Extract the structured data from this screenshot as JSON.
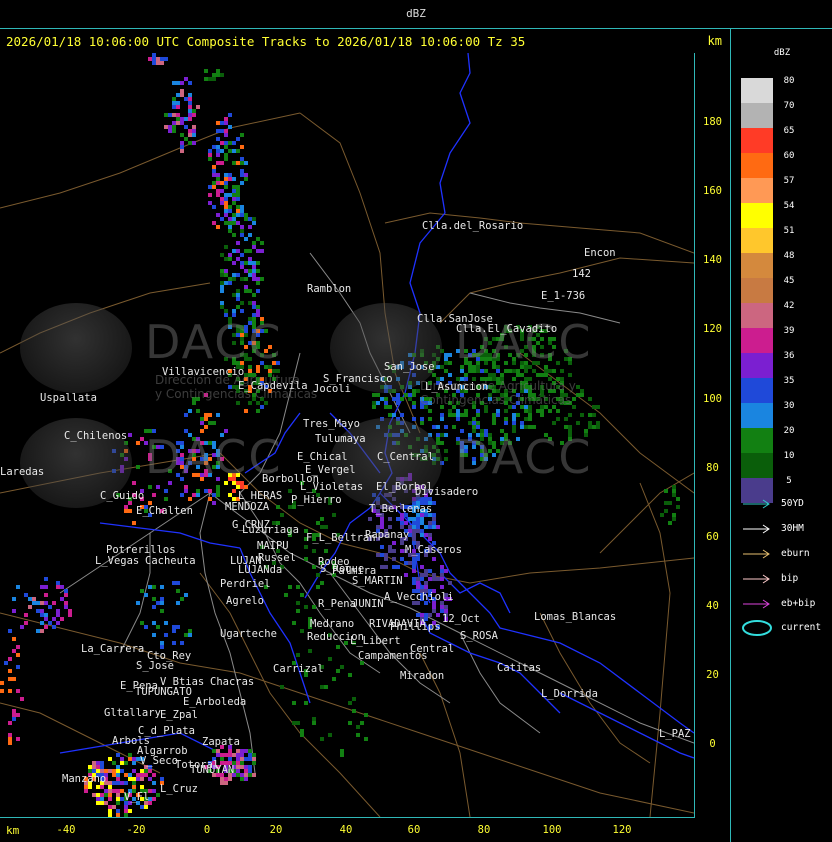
{
  "top_title": "dBZ",
  "header": {
    "title": "2026/01/18 10:06:00 UTC Composite Tracks to 2026/01/18 10:06:00 Tz 35",
    "km": "km"
  },
  "y_ticks": [
    "180",
    "160",
    "140",
    "120",
    "100",
    "80",
    "60",
    "40",
    "20",
    "0"
  ],
  "x_ticks": [
    "-40",
    "-20",
    "0",
    "20",
    "40",
    "60",
    "80",
    "100",
    "120"
  ],
  "x_km": "km",
  "legend": {
    "title": "dBZ",
    "scale": [
      {
        "value": "80",
        "color": "#d9d9d9"
      },
      {
        "value": "70",
        "color": "#b3b3b3"
      },
      {
        "value": "65",
        "color": "#ff3b26"
      },
      {
        "value": "60",
        "color": "#ff6a12"
      },
      {
        "value": "57",
        "color": "#ff9955"
      },
      {
        "value": "54",
        "color": "#ffff00"
      },
      {
        "value": "51",
        "color": "#ffc72c"
      },
      {
        "value": "48",
        "color": "#d4893d"
      },
      {
        "value": "45",
        "color": "#c87a42"
      },
      {
        "value": "42",
        "color": "#cc6680"
      },
      {
        "value": "39",
        "color": "#cc1d8f"
      },
      {
        "value": "36",
        "color": "#7b1fd1"
      },
      {
        "value": "35",
        "color": "#1f49d9"
      },
      {
        "value": "30",
        "color": "#1a85e0"
      },
      {
        "value": "20",
        "color": "#128012"
      },
      {
        "value": "10",
        "color": "#0a5e0a"
      },
      {
        "value": "5",
        "color": "#4a3c8c"
      }
    ],
    "tracks": [
      {
        "label": "50YD",
        "color": "#33cccc"
      },
      {
        "label": "30HM",
        "color": "#ffffff"
      },
      {
        "label": "eburn",
        "color": "#e8c070"
      },
      {
        "label": "bip",
        "color": "#ffcccc"
      },
      {
        "label": "eb+bip",
        "color": "#dd44dd"
      }
    ],
    "current_label": "current",
    "current_color": "#33dddd"
  },
  "watermark": {
    "brand": "DACC",
    "sub_right": "Dirección de Agricultura y Contingencias Climáticas",
    "sub_left_1": "Dirección de Agricultura",
    "sub_left_2": "y Contingencias Climáticas"
  },
  "cities": [
    "Clla.del_Rosario",
    "Encon",
    "142",
    "E_1-736",
    "Ramblon",
    "Clla.SanJose",
    "Clla.El_Cavadito",
    "Villavicencio",
    "E_Capdevila",
    "S_Francisco",
    "Jocoli",
    "San_Jose",
    "L_Asuncion",
    "Uspallata",
    "Tres_Mayo",
    "Tulumaya",
    "C_Chilenos",
    "E_Chical",
    "E_Vergel",
    "C_Central",
    "Borbollon",
    "L_Violetas",
    "Divisadero",
    "Laredas",
    "C_Guido",
    "L_HERAS",
    "P_Hierro",
    "El_Borbol",
    "E_Chalten",
    "MENDOZA",
    "T_Berlenas",
    "G_CRUZ",
    "Luzuriaga",
    "F_L_Beltran",
    "Rapanay",
    "Potrerillos",
    "MAIPU",
    "Russel",
    "Rodeo",
    "M_Caseros",
    "L_Vegas",
    "Cacheuta",
    "LUJAN",
    "S_Roque",
    "Palmira",
    "Perdriel",
    "S_MARTIN",
    "LUJANda",
    "Agrelo",
    "R_Pena",
    "JUNIN",
    "A_Vecchioli",
    "Lomas_Blancas",
    "Ugarteche",
    "Medrano",
    "RIVADAVIA",
    "12_Oct",
    "S_ROSA",
    "Reduccion",
    "La_Carrera",
    "Cto_Rey",
    "L_Libert",
    "Phillips",
    "S_Jose",
    "Carrizal",
    "Campamentos",
    "Central",
    "Catitas",
    "Miradon",
    "E_Pena",
    "V_Btias",
    "Chacras",
    "TUPUNGATO",
    "L_Dorrida",
    "E_Arboleda",
    "Gltallary",
    "E_Zpal",
    "L_PAZ",
    "C_d_Plata",
    "Arbols",
    "Zapata",
    "Algarrob",
    "V_Seco",
    "Totoral",
    "TUNUYAN",
    "Manzano",
    "V_Fl",
    "L_Cruz"
  ]
}
